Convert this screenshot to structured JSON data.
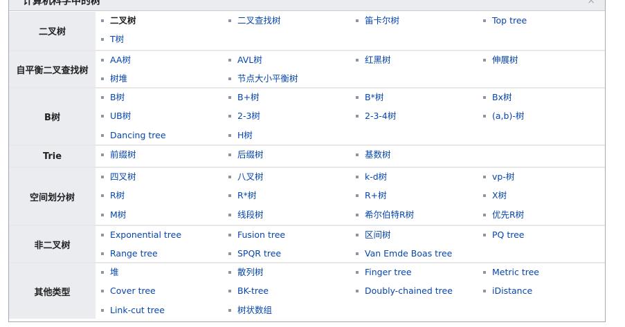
{
  "title": "计算机科学中的树",
  "close": "×",
  "groups": [
    {
      "label": "二叉树",
      "items": [
        "二叉树",
        "二叉查找树",
        "笛卡尔树",
        "Top tree",
        "T树"
      ]
    },
    {
      "label": "自平衡二叉查找树",
      "items": [
        "AA树",
        "AVL树",
        "红黑树",
        "伸展树",
        "树堆",
        "节点大小平衡树"
      ]
    },
    {
      "label": "B树",
      "items": [
        "B树",
        "B+树",
        "B*树",
        "Bx树",
        "UB树",
        "2-3树",
        "2-3-4树",
        "(a,b)-树",
        "Dancing tree",
        "H树"
      ]
    },
    {
      "label": "Trie",
      "items": [
        "前缀树",
        "后缀树",
        "基数树"
      ]
    },
    {
      "label": "空间划分树",
      "items": [
        "四叉树",
        "八叉树",
        "k-d树",
        "vp-树",
        "R树",
        "R*树",
        "R+树",
        "X树",
        "M树",
        "线段树",
        "希尔伯特R树",
        "优先R树"
      ]
    },
    {
      "label": "非二叉树",
      "items": [
        "Exponential tree",
        "Fusion tree",
        "区间树",
        "PQ tree",
        "Range tree",
        "SPQR tree",
        "Van Emde Boas tree"
      ]
    },
    {
      "label": "其他类型",
      "items": [
        "堆",
        "散列树",
        "Finger tree",
        "Metric tree",
        "Cover tree",
        "BK-tree",
        "Doubly-chained tree",
        "iDistance",
        "Link-cut tree",
        "树状数组"
      ]
    }
  ]
}
